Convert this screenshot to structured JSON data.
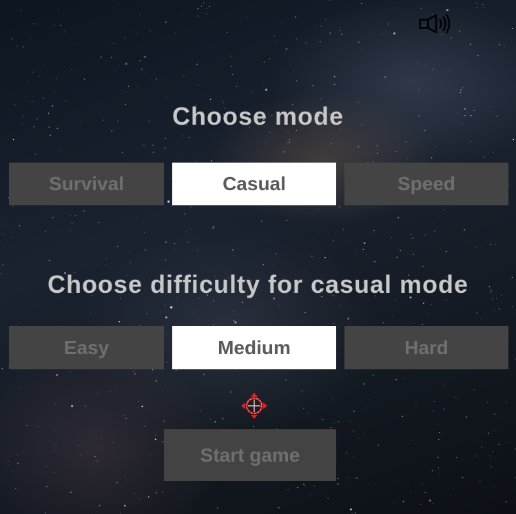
{
  "mode_section": {
    "heading": "Choose mode",
    "options": [
      {
        "label": "Survival",
        "selected": false
      },
      {
        "label": "Casual",
        "selected": true
      },
      {
        "label": "Speed",
        "selected": false
      }
    ]
  },
  "difficulty_section": {
    "heading": "Choose difficulty for casual mode",
    "options": [
      {
        "label": "Easy",
        "selected": false
      },
      {
        "label": "Medium",
        "selected": true
      },
      {
        "label": "Hard",
        "selected": false
      }
    ]
  },
  "start_button": {
    "label": "Start game"
  },
  "icons": {
    "sound": "speaker-on-icon",
    "cursor": "crosshair-cursor-icon"
  },
  "colors": {
    "heading_text": "#c8c8c8",
    "button_bg": "#444444",
    "button_text": "#6f6f6f",
    "selected_bg": "#ffffff",
    "selected_text": "#5a5a5a",
    "cursor_accent": "#e02020"
  }
}
